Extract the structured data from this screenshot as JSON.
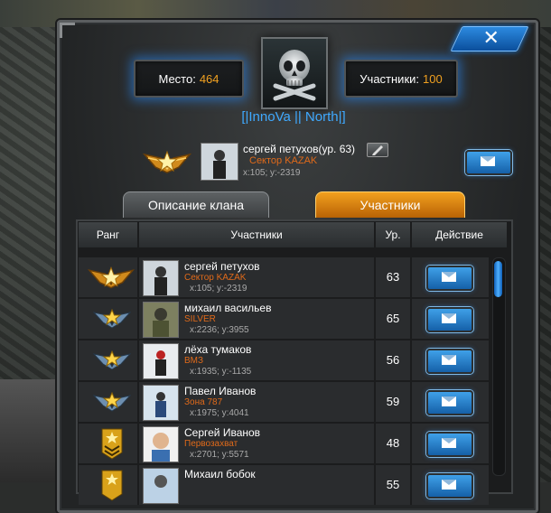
{
  "header": {
    "place_label": "Место:",
    "place_value": "464",
    "members_label": "Участники:",
    "members_value": "100",
    "clan_name": "[|InnoVa || North|]"
  },
  "leader": {
    "name": "сергей петухов(ур. 63)",
    "sector": "Сектор KAZAK",
    "coords": "x:105; y:-2319"
  },
  "tabs": {
    "description": "Описание клана",
    "members": "Участники"
  },
  "table": {
    "columns": [
      "Ранг",
      "Участники",
      "Ур.",
      "Действие"
    ],
    "rows": [
      {
        "name": "сергей петухов",
        "sector": "Сектор KAZAK",
        "coords": "x:105; y:-2319",
        "level": "63",
        "rank_icon": "rank-leader-icon"
      },
      {
        "name": "михаил васильев",
        "sector": "SILVER",
        "coords": "x:2236; y:3955",
        "level": "65",
        "rank_icon": "rank-officer-icon"
      },
      {
        "name": "лёха тумаков",
        "sector": "ВМЗ",
        "coords": "x:1935; y:-1135",
        "level": "56",
        "rank_icon": "rank-officer-icon"
      },
      {
        "name": "Павел Иванов",
        "sector": "Зона 787",
        "coords": "x:1975; y:4041",
        "level": "59",
        "rank_icon": "rank-officer-icon"
      },
      {
        "name": "Сергей Иванов",
        "sector": "Первозахват",
        "coords": "x:2701; y:5571",
        "level": "48",
        "rank_icon": "rank-sergeant-icon"
      },
      {
        "name": "Михаил бобок",
        "sector": "",
        "coords": "",
        "level": "55",
        "rank_icon": "rank-sergeant-icon"
      }
    ]
  },
  "colors": {
    "accent_orange": "#f0a020",
    "sector_orange": "#e06a1a",
    "clan_blue": "#3fa9ff"
  }
}
